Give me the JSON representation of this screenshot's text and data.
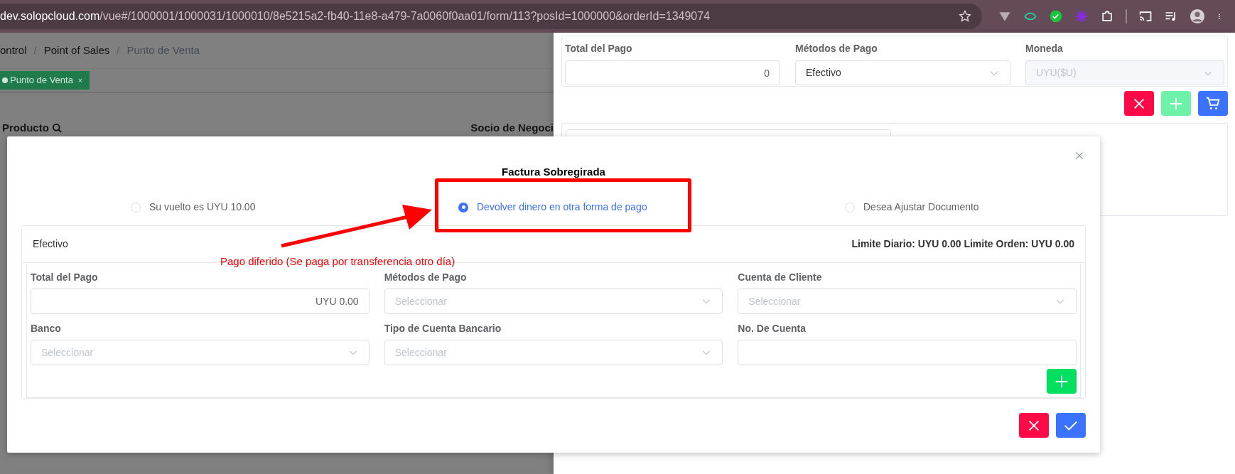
{
  "browser": {
    "url_host": "dev.solopcloud.com",
    "url_path": "/vue#/1000001/1000031/1000010/8e5215a2-fb40-11e8-a479-7a0060f0aa01/form/113?posId=1000000&orderId=1349074"
  },
  "background_page": {
    "breadcrumb": [
      {
        "label": "ontrol",
        "current": false
      },
      {
        "label": "Point of Sales",
        "current": false
      },
      {
        "label": "Punto de Venta",
        "current": true
      }
    ],
    "breadcrumb_separator": "/",
    "tags": [
      {
        "label": "Punto de Venta",
        "close": "×",
        "color": "#1f7a4c"
      }
    ],
    "product_label": "Producto",
    "partner_label": "Socio de Negoci"
  },
  "drawer": {
    "fields": [
      {
        "label": "Total del Pago",
        "kind": "input",
        "value": "0",
        "disabled": false
      },
      {
        "label": "Métodos de Pago",
        "kind": "select",
        "value": "Efectivo",
        "disabled": false
      },
      {
        "label": "Moneda",
        "kind": "select",
        "value": "UYU($U)",
        "disabled": true
      }
    ],
    "buttons": [
      {
        "kind": "cancel",
        "disabled": false
      },
      {
        "kind": "add",
        "disabled": true
      },
      {
        "kind": "cart",
        "disabled": false
      }
    ]
  },
  "modal": {
    "title": "Factura Sobregirada",
    "options": [
      {
        "label": "Su vuelto es UYU 10.00",
        "selected": false
      },
      {
        "label": "Devolver dinero en otra forma de pago",
        "selected": true
      },
      {
        "label": "Desea Ajustar Documento",
        "selected": false
      }
    ],
    "card": {
      "title": "Efectivo",
      "limits": "Limite Diario: UYU 0.00 Limite Orden: UYU 0.00",
      "fields": [
        {
          "label": "Total del Pago",
          "kind": "input",
          "value": "UYU 0.00"
        },
        {
          "label": "Métodos de Pago",
          "kind": "select",
          "placeholder": "Seleccionar"
        },
        {
          "label": "Cuenta de Cliente",
          "kind": "select",
          "placeholder": "Seleccionar"
        },
        {
          "label": "Banco",
          "kind": "select",
          "placeholder": "Seleccionar"
        },
        {
          "label": "Tipo de Cuenta Bancario",
          "kind": "select",
          "placeholder": "Seleccionar"
        },
        {
          "label": "No. De Cuenta",
          "kind": "input"
        }
      ]
    },
    "buttons": [
      {
        "kind": "cancel"
      },
      {
        "kind": "confirm"
      }
    ]
  },
  "annotation": {
    "text": "Pago diferido (Se paga por transferencia otro día)"
  }
}
